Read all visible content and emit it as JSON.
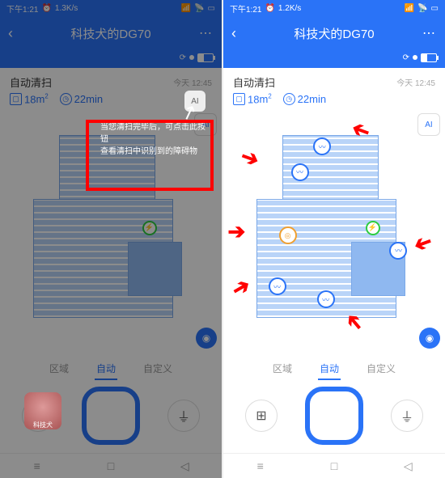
{
  "status": {
    "time": "下午1:21",
    "speed_left": "1.3K/s",
    "speed_right": "1.2K/s",
    "alarm_icon": "alarm-icon",
    "signal_icon": "signal-icon",
    "wifi_icon": "wifi-icon",
    "battery_icon": "battery-icon",
    "battery_pct": "31"
  },
  "header": {
    "back_icon": "‹",
    "title": "科技犬的DG70",
    "more_icon": "⋯"
  },
  "substatus": {
    "transfer_icon": "sync-icon"
  },
  "info": {
    "mode": "自动清扫",
    "timestamp": "今天 12:45",
    "area_icon": "area-icon",
    "area_value": "18",
    "area_unit": "m²",
    "duration_icon": "clock-icon",
    "duration_value": "22",
    "duration_unit": "min"
  },
  "map": {
    "ai_button_label": "AI",
    "camera_button_icon": "camera-icon",
    "obstacles": [
      "obstacle",
      "obstacle",
      "obstacle",
      "obstacle",
      "obstacle",
      "obstacle"
    ],
    "dock_icon": "charge-dock"
  },
  "tooltip": {
    "line1": "当您清扫完毕后，可点击此按钮",
    "line2": "查看清扫中识别到的障碍物"
  },
  "tabs": {
    "zone": "区域",
    "auto": "自动",
    "custom": "自定义"
  },
  "controls": {
    "wall_icon": "wall-icon",
    "start_icon": "start-icon",
    "dock_icon": "dock-icon"
  },
  "navbar": {
    "menu_icon": "menu-icon",
    "home_icon": "home-icon",
    "back_icon": "back-icon"
  },
  "watermark": "科技犬"
}
